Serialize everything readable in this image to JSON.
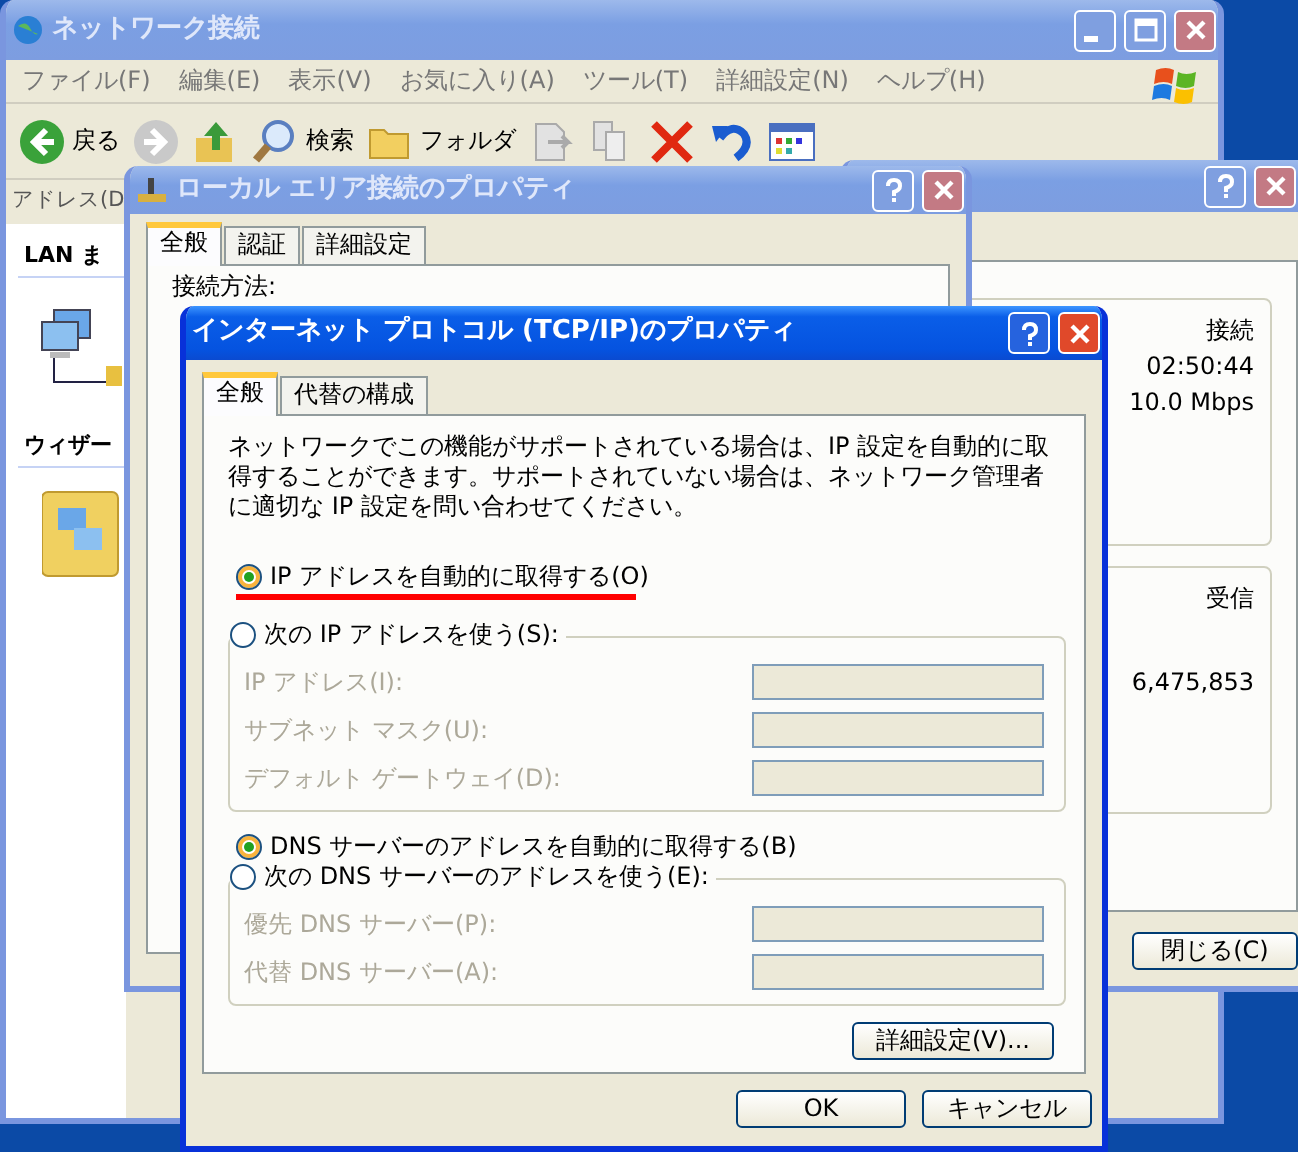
{
  "explorer": {
    "title": "ネットワーク接続",
    "menu": [
      "ファイル(F)",
      "編集(E)",
      "表示(V)",
      "お気に入り(A)",
      "ツール(T)",
      "詳細設定(N)",
      "ヘルプ(H)"
    ],
    "toolbar": [
      {
        "kind": "back",
        "label": "戻る"
      },
      {
        "kind": "forward"
      },
      {
        "kind": "up"
      },
      {
        "kind": "search",
        "label": "検索"
      },
      {
        "kind": "folders",
        "label": "フォルダ"
      },
      {
        "kind": "move"
      },
      {
        "kind": "copy"
      },
      {
        "kind": "delete"
      },
      {
        "kind": "undo"
      },
      {
        "kind": "views"
      }
    ],
    "address_label": "アドレス(D",
    "sidebar": [
      {
        "heading": "LAN ま"
      },
      {
        "heading": "ウィザー"
      }
    ]
  },
  "status_window": {
    "groups": [
      {
        "texts": [
          "接続",
          "02:50:44",
          "10.0 Mbps"
        ]
      },
      {
        "texts": [
          "受信",
          "6,475,853"
        ]
      }
    ],
    "close_button": "閉じる(C)"
  },
  "lan_properties": {
    "title": "ローカル エリア接続のプロパティ",
    "tabs": [
      {
        "label": "全般",
        "selected": true
      },
      {
        "label": "認証",
        "selected": false
      },
      {
        "label": "詳細設定",
        "selected": false
      }
    ],
    "label": "接続方法:"
  },
  "tcpip_dialog": {
    "title": "インターネット プロトコル (TCP/IP)のプロパティ",
    "tabs": [
      {
        "label": "全般",
        "selected": true
      },
      {
        "label": "代替の構成",
        "selected": false
      }
    ],
    "description": "ネットワークでこの機能がサポートされている場合は、IP 設定を自動的に取得することができます。サポートされていない場合は、ネットワーク管理者に適切な IP 設定を問い合わせてください。",
    "ip_options": [
      {
        "label": "IP アドレスを自動的に取得する(O)",
        "selected": true,
        "underlined": true
      },
      {
        "label": "次の IP アドレスを使う(S):",
        "selected": false,
        "underlined": false
      }
    ],
    "ip_fields": [
      {
        "label": "IP アドレス(I):",
        "disabled": true
      },
      {
        "label": "サブネット マスク(U):",
        "disabled": true
      },
      {
        "label": "デフォルト ゲートウェイ(D):",
        "disabled": true
      }
    ],
    "dns_options": [
      {
        "label": "DNS サーバーのアドレスを自動的に取得する(B)",
        "selected": true
      },
      {
        "label": "次の DNS サーバーのアドレスを使う(E):",
        "selected": false
      }
    ],
    "dns_fields": [
      {
        "label": "優先 DNS サーバー(P):",
        "disabled": true
      },
      {
        "label": "代替 DNS サーバー(A):",
        "disabled": true
      }
    ],
    "advanced_button": "詳細設定(V)...",
    "buttons": [
      "OK",
      "キャンセル"
    ]
  }
}
